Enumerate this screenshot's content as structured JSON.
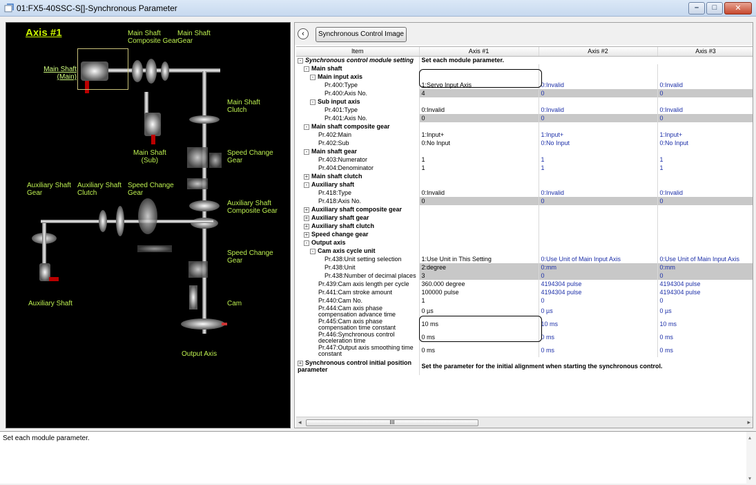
{
  "window": {
    "title": "01:FX5-40SSC-S[]-Synchronous Parameter"
  },
  "diagram": {
    "axis_title": "Axis #1",
    "labels": {
      "main_shaft_composite_gear": "Main Shaft\nComposite Gear",
      "main_shaft_gear": "Main Shaft\nGear",
      "main_shaft_main": "Main Shaft\n(Main)",
      "main_shaft_clutch": "Main Shaft\nClutch",
      "main_shaft_sub": "Main Shaft\n(Sub)",
      "speed_change_gear_1": "Speed Change\nGear",
      "aux_shaft_gear": "Auxiliary Shaft\nGear",
      "aux_shaft_clutch": "Auxiliary Shaft\nClutch",
      "speed_change_gear_2": "Speed Change\nGear",
      "aux_shaft_composite_gear": "Auxiliary Shaft\nComposite Gear",
      "speed_change_gear_3": "Speed Change\nGear",
      "auxiliary_shaft": "Auxiliary Shaft",
      "cam": "Cam",
      "output_axis": "Output Axis"
    }
  },
  "toolbar": {
    "sync_button": "Synchronous Control Image"
  },
  "table": {
    "headers": [
      "Item",
      "Axis #1",
      "Axis #2",
      "Axis #3"
    ],
    "rows": [
      {
        "label": "Synchronous control module setting",
        "style": "bi",
        "toggle": "-",
        "indent": 0,
        "v": [
          "Set each module parameter.",
          "",
          ""
        ],
        "span": true
      },
      {
        "label": "Main shaft",
        "style": "b",
        "toggle": "-",
        "indent": 1,
        "v": [
          "",
          "",
          ""
        ]
      },
      {
        "label": "Main input axis",
        "style": "b",
        "toggle": "-",
        "indent": 2,
        "v": [
          "",
          "",
          ""
        ]
      },
      {
        "label": "Pr.400:Type",
        "indent": 3,
        "v": [
          "1:Servo Input Axis",
          "0:Invalid",
          "0:Invalid"
        ]
      },
      {
        "label": "Pr.400:Axis No.",
        "indent": 3,
        "gray": true,
        "v": [
          "4",
          "0",
          "0"
        ]
      },
      {
        "label": "Sub input axis",
        "style": "b",
        "toggle": "-",
        "indent": 2,
        "v": [
          "",
          "",
          ""
        ]
      },
      {
        "label": "Pr.401:Type",
        "indent": 3,
        "v": [
          "0:Invalid",
          "0:Invalid",
          "0:Invalid"
        ]
      },
      {
        "label": "Pr.401:Axis No.",
        "indent": 3,
        "gray": true,
        "v": [
          "0",
          "0",
          "0"
        ]
      },
      {
        "label": "Main shaft composite gear",
        "style": "b",
        "toggle": "-",
        "indent": 1,
        "v": [
          "",
          "",
          ""
        ]
      },
      {
        "label": "Pr.402:Main",
        "indent": 2,
        "v": [
          "1:Input+",
          "1:Input+",
          "1:Input+"
        ]
      },
      {
        "label": "Pr.402:Sub",
        "indent": 2,
        "v": [
          "0:No Input",
          "0:No Input",
          "0:No Input"
        ]
      },
      {
        "label": "Main shaft gear",
        "style": "b",
        "toggle": "-",
        "indent": 1,
        "v": [
          "",
          "",
          ""
        ]
      },
      {
        "label": "Pr.403:Numerator",
        "indent": 2,
        "v": [
          "1",
          "1",
          "1"
        ]
      },
      {
        "label": "Pr.404:Denominator",
        "indent": 2,
        "v": [
          "1",
          "1",
          "1"
        ]
      },
      {
        "label": "Main shaft clutch",
        "style": "b",
        "toggle": "+",
        "indent": 1,
        "v": [
          "",
          "",
          ""
        ]
      },
      {
        "label": "Auxiliary shaft",
        "style": "b",
        "toggle": "-",
        "indent": 1,
        "v": [
          "",
          "",
          ""
        ]
      },
      {
        "label": "Pr.418:Type",
        "indent": 2,
        "v": [
          "0:Invalid",
          "0:Invalid",
          "0:Invalid"
        ]
      },
      {
        "label": "Pr.418:Axis No.",
        "indent": 2,
        "gray": true,
        "v": [
          "0",
          "0",
          "0"
        ]
      },
      {
        "label": "Auxiliary shaft composite gear",
        "style": "b",
        "toggle": "+",
        "indent": 1,
        "v": [
          "",
          "",
          ""
        ]
      },
      {
        "label": "Auxiliary shaft gear",
        "style": "b",
        "toggle": "+",
        "indent": 1,
        "v": [
          "",
          "",
          ""
        ]
      },
      {
        "label": "Auxiliary shaft clutch",
        "style": "b",
        "toggle": "+",
        "indent": 1,
        "v": [
          "",
          "",
          ""
        ]
      },
      {
        "label": "Speed change gear",
        "style": "b",
        "toggle": "+",
        "indent": 1,
        "v": [
          "",
          "",
          ""
        ]
      },
      {
        "label": "Output axis",
        "style": "b",
        "toggle": "-",
        "indent": 1,
        "v": [
          "",
          "",
          ""
        ]
      },
      {
        "label": "Cam axis cycle unit",
        "style": "b",
        "toggle": "-",
        "indent": 2,
        "v": [
          "",
          "",
          ""
        ]
      },
      {
        "label": "Pr.438:Unit setting selection",
        "indent": 3,
        "v": [
          "1:Use Unit in This Setting",
          "0:Use Unit of Main Input Axis",
          "0:Use Unit of Main Input Axis"
        ]
      },
      {
        "label": "Pr.438:Unit",
        "indent": 3,
        "gray": true,
        "v": [
          "2:degree",
          "0:mm",
          "0:mm"
        ]
      },
      {
        "label": "Pr.438:Number of decimal places",
        "indent": 3,
        "gray": true,
        "v": [
          "3",
          "0",
          "0"
        ]
      },
      {
        "label": "Pr.439:Cam axis length per cycle",
        "indent": 2,
        "v": [
          "360.000 degree",
          "4194304 pulse",
          "4194304 pulse"
        ]
      },
      {
        "label": "Pr.441:Cam stroke amount",
        "indent": 2,
        "v": [
          "100000 pulse",
          "4194304 pulse",
          "4194304 pulse"
        ]
      },
      {
        "label": "Pr.440:Cam No.",
        "indent": 2,
        "v": [
          "1",
          "0",
          "0"
        ]
      },
      {
        "label": "Pr.444:Cam axis phase compensation advance time",
        "indent": 2,
        "tall": true,
        "v": [
          "0 µs",
          "0 µs",
          "0 µs"
        ]
      },
      {
        "label": "Pr.445:Cam axis phase compensation time constant",
        "indent": 2,
        "tall": true,
        "v": [
          "10 ms",
          "10 ms",
          "10 ms"
        ]
      },
      {
        "label": "Pr.446:Synchronous control deceleration time",
        "indent": 2,
        "tall": true,
        "v": [
          "0 ms",
          "0 ms",
          "0 ms"
        ]
      },
      {
        "label": "Pr.447:Output axis smoothing time constant",
        "indent": 2,
        "tall": true,
        "v": [
          "0 ms",
          "0 ms",
          "0 ms"
        ]
      },
      {
        "label": "Synchronous control initial position parameter",
        "style": "b",
        "toggle": "+",
        "indent": 0,
        "tall2": true,
        "v": [
          "Set the parameter for the initial alignment when starting the synchronous control.",
          "",
          ""
        ],
        "span": true
      }
    ]
  },
  "scrollbar": {
    "thumb_label": "III"
  },
  "status": {
    "text": "Set each module parameter."
  }
}
